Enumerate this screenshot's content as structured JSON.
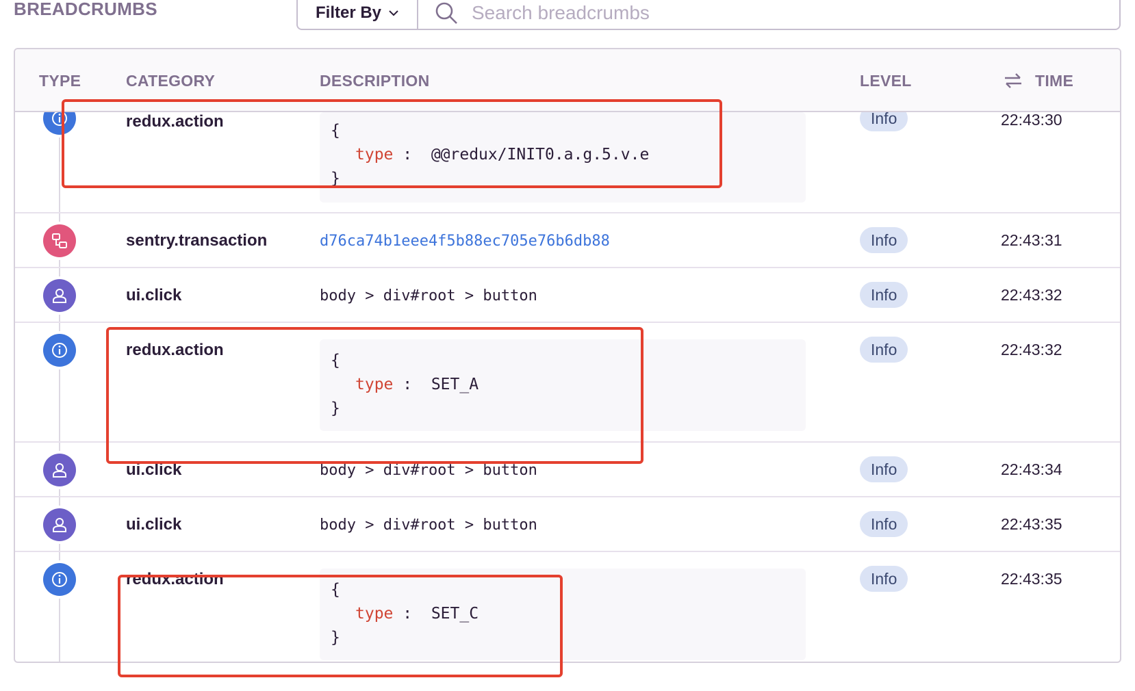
{
  "header": {
    "section_title": "BREADCRUMBS",
    "filter_label": "Filter By",
    "search_placeholder": "Search breadcrumbs"
  },
  "table": {
    "columns": {
      "type": "TYPE",
      "category": "CATEGORY",
      "description": "DESCRIPTION",
      "level": "LEVEL",
      "time": "TIME"
    }
  },
  "rows": [
    {
      "icon": "info-icon",
      "category": "redux.action",
      "code_open": "{",
      "code_key": "type",
      "code_sep": ":",
      "code_value": "@@redux/INIT0.a.g.5.v.e",
      "code_close": "}",
      "level": "Info",
      "time": "22:43:30"
    },
    {
      "icon": "transaction-icon",
      "category": "sentry.transaction",
      "description": "d76ca74b1eee4f5b88ec705e76b6db88",
      "level": "Info",
      "time": "22:43:31"
    },
    {
      "icon": "user-icon",
      "category": "ui.click",
      "description": "body > div#root > button",
      "level": "Info",
      "time": "22:43:32"
    },
    {
      "icon": "info-icon",
      "category": "redux.action",
      "code_open": "{",
      "code_key": "type",
      "code_sep": ":",
      "code_value": "SET_A",
      "code_close": "}",
      "level": "Info",
      "time": "22:43:32"
    },
    {
      "icon": "user-icon",
      "category": "ui.click",
      "description": "body > div#root > button",
      "level": "Info",
      "time": "22:43:34"
    },
    {
      "icon": "user-icon",
      "category": "ui.click",
      "description": "body > div#root > button",
      "level": "Info",
      "time": "22:43:35"
    },
    {
      "icon": "info-icon",
      "category": "redux.action",
      "code_open": "{",
      "code_key": "type",
      "code_sep": ":",
      "code_value": "SET_C",
      "code_close": "}",
      "level": "Info",
      "time": "22:43:35"
    }
  ],
  "colors": {
    "info_blue": "#3d74db",
    "transaction_red": "#e1567c",
    "user_purple": "#6c5fc7",
    "annotation_red": "#e4402f"
  }
}
